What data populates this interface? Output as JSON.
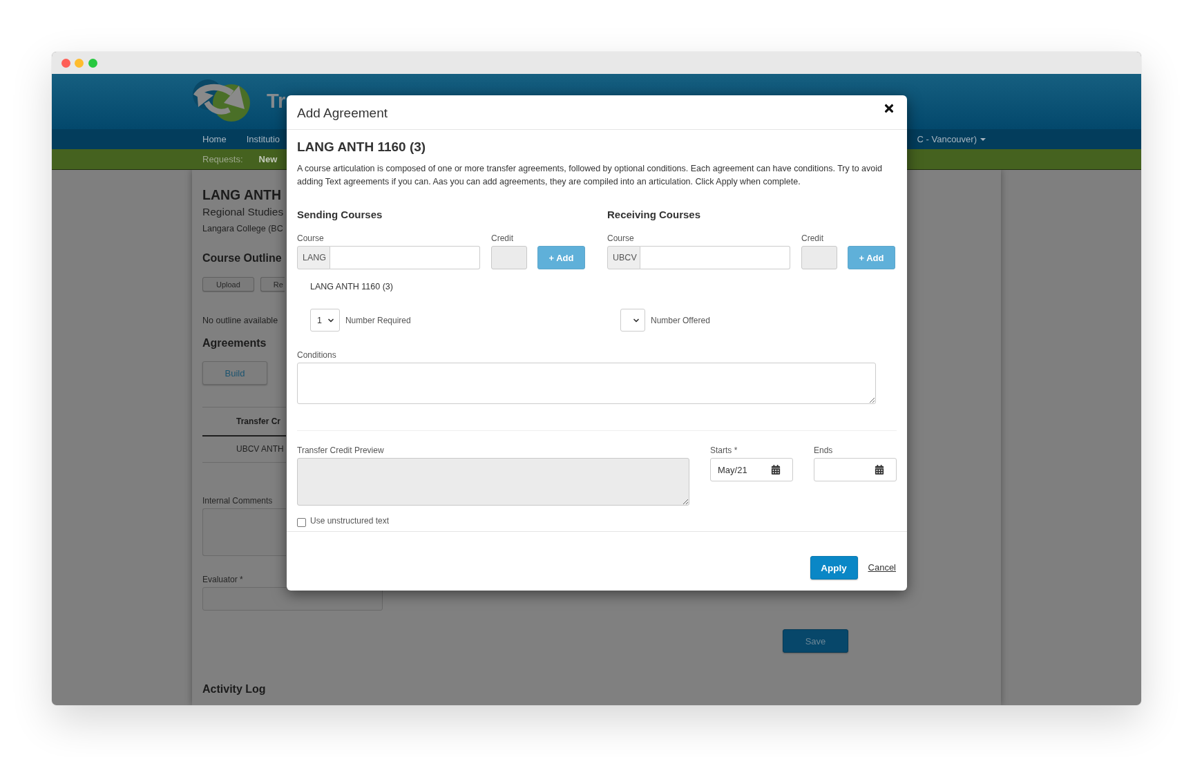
{
  "header": {
    "title": "Tr",
    "nav": [
      {
        "label": "Home"
      },
      {
        "label": "Institutio"
      }
    ],
    "account_menu": {
      "label": "C - Vancouver)"
    }
  },
  "requests_bar": {
    "label": "Requests:",
    "links": [
      {
        "label": "New"
      }
    ]
  },
  "page": {
    "title": "LANG ANTH",
    "subtitle": "Regional Studies",
    "institution": "Langara College (BC",
    "course_outline": {
      "heading": "Course Outline",
      "buttons": [
        {
          "label": "Upload"
        },
        {
          "label": "Re"
        }
      ],
      "message": "No outline available"
    },
    "agreements": {
      "heading": "Agreements",
      "buttons": [
        {
          "label": "Build"
        }
      ],
      "table": {
        "columns": [
          "Transfer Cr"
        ],
        "rows": [
          [
            "UBCV ANTH"
          ]
        ]
      }
    },
    "internal_comments": {
      "label": "Internal Comments"
    },
    "evaluator": {
      "label": "Evaluator *"
    },
    "save_button": {
      "label": "Save"
    },
    "activity_log": {
      "heading": "Activity Log"
    }
  },
  "modal": {
    "title": "Add Agreement",
    "course": "LANG ANTH 1160 (3)",
    "description": "A course articulation is composed of one or more transfer agreements, followed by optional conditions. Each agreement can have conditions. Try to avoid adding Text agreements if you can. Aas you can add agreements, they are compiled into an articulation. Click Apply when complete.",
    "sides": [
      {
        "heading": "Sending Courses",
        "course_field": {
          "label": "Course",
          "prefix": "LANG"
        },
        "credit_field": {
          "label": "Credit",
          "disabled": true
        },
        "add_button": {
          "label": "+ Add",
          "disabled": true
        },
        "courses": [
          {
            "label": "LANG ANTH 1160 (3)"
          }
        ],
        "number_select": {
          "value": "1",
          "label": "Number Required"
        }
      },
      {
        "heading": "Receiving Courses",
        "course_field": {
          "label": "Course",
          "prefix": "UBCV"
        },
        "credit_field": {
          "label": "Credit",
          "disabled": true
        },
        "add_button": {
          "label": "+ Add",
          "disabled": true
        },
        "number_select": {
          "label": "Number Offered"
        }
      }
    ],
    "conditions": {
      "label": "Conditions"
    },
    "preview": {
      "label": "Transfer Credit Preview",
      "disabled": true
    },
    "dates": [
      {
        "label": "Starts *",
        "value": "May/21"
      },
      {
        "label": "Ends"
      }
    ],
    "unstructured_text": {
      "label": "Use unstructured text",
      "checked": false
    },
    "apply_button": {
      "label": "Apply"
    },
    "cancel_link": {
      "label": "Cancel"
    }
  }
}
